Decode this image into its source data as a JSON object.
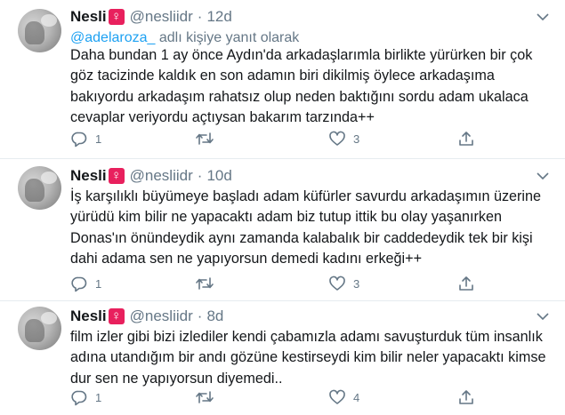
{
  "tweets": [
    {
      "name": "Nesli",
      "badge": "♀",
      "handle": "@nesliidr",
      "separator": "·",
      "time": "12d",
      "reply_to": {
        "mention": "@adelaroza_",
        "text": "adlı kişiye yanıt olarak"
      },
      "lines": [
        "Daha bundan 1 ay önce Aydın'da arkadaşlarımla birlikte yürürken bir çok",
        "göz tacizinde kaldık en son adamın biri dikilmiş öylece arkadaşıma",
        "bakıyordu arkadaşım rahatsız olup neden baktığını sordu adam ukalaca",
        "cevaplar veriyordu açtıysan bakarım tarzında++"
      ],
      "replies": "1",
      "retweets": "",
      "likes": "3"
    },
    {
      "name": "Nesli",
      "badge": "♀",
      "handle": "@nesliidr",
      "separator": "·",
      "time": "10d",
      "lines": [
        "İş karşılıklı büyümeye başladı adam küfürler savurdu arkadaşımın üzerine",
        "yürüdü kim bilir ne yapacaktı adam biz tutup ittik bu olay yaşanırken",
        "Donas'ın önündeydik aynı zamanda kalabalık bir caddedeydik tek bir kişi",
        "dahi adama sen ne yapıyorsun demedi kadını erkeği++"
      ],
      "replies": "1",
      "retweets": "",
      "likes": "3"
    },
    {
      "name": "Nesli",
      "badge": "♀",
      "handle": "@nesliidr",
      "separator": "·",
      "time": "8d",
      "lines": [
        "film izler gibi bizi izlediler kendi çabamızla adamı savuşturduk tüm insanlık",
        "adına utandığım bir andı gözüne kestirseydi kim bilir neler yapacaktı kimse",
        "dur sen ne yapıyorsun diyemedi.."
      ],
      "replies": "1",
      "retweets": "",
      "likes": "4"
    }
  ],
  "colors": {
    "text": "#14171a",
    "muted": "#657786",
    "link": "#1da1f2",
    "badge": "#e8205d",
    "divider": "#e6ecf0"
  },
  "icons": [
    "reply-icon",
    "retweet-icon",
    "like-icon",
    "share-icon",
    "chevron-down-icon",
    "venus-icon"
  ]
}
